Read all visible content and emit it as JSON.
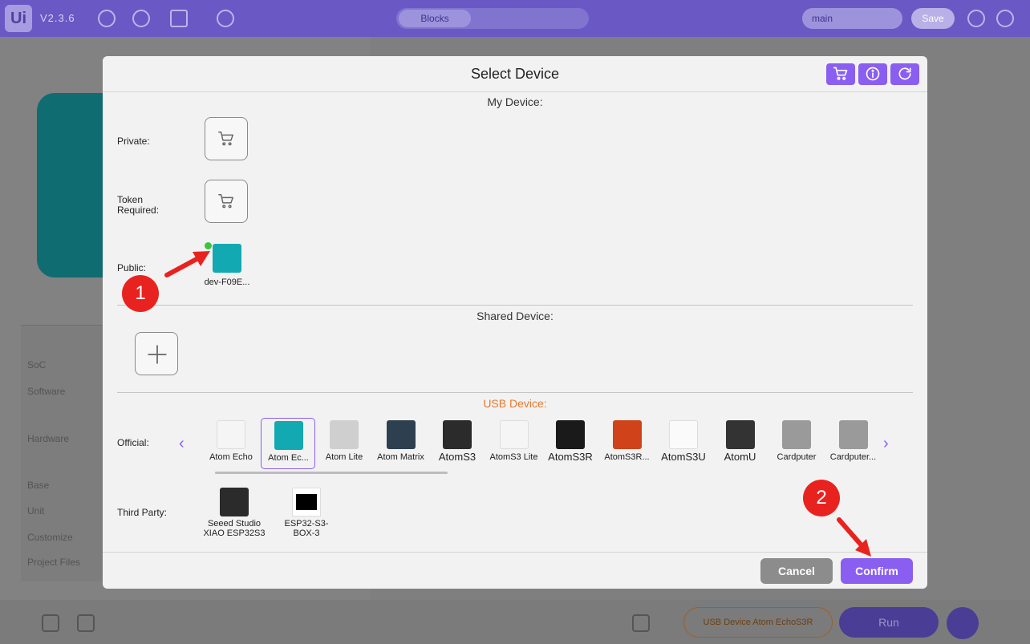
{
  "app": {
    "logo_text": "Ui",
    "version": "V2.3.6",
    "tab_blocks": "Blocks",
    "branch": "main",
    "save_label": "Save",
    "sidebar_rows": [
      "SoC",
      "Software",
      "Hardware",
      "Base",
      "Unit",
      "Customize",
      "Project Files"
    ],
    "usb_status": "USB Device  Atom EchoS3R",
    "run_label": "Run"
  },
  "modal": {
    "title": "Select Device",
    "header_buttons": [
      "cart-icon",
      "info-icon",
      "refresh-icon"
    ],
    "my_device": {
      "title": "My Device:",
      "private_label": "Private:",
      "token_label_line1": "Token",
      "token_label_line2": "Required:",
      "public_label": "Public:",
      "public_device_name": "dev-F09E..."
    },
    "shared_device": {
      "title": "Shared Device:"
    },
    "usb_device": {
      "title": "USB Device:",
      "official_label": "Official:",
      "third_party_label": "Third Party:",
      "official_devices": [
        {
          "label": "Atom Echo",
          "color": "#f5f5f5",
          "big": false
        },
        {
          "label": "Atom Ec...",
          "color": "#12a9b3",
          "big": false,
          "selected": true
        },
        {
          "label": "Atom Lite",
          "color": "#cfcfcf",
          "big": false
        },
        {
          "label": "Atom Matrix",
          "color": "#2e4050",
          "big": false
        },
        {
          "label": "AtomS3",
          "color": "#2b2b2b",
          "big": true
        },
        {
          "label": "AtomS3 Lite",
          "color": "#f5f5f5",
          "big": false
        },
        {
          "label": "AtomS3R",
          "color": "#1a1a1a",
          "big": true
        },
        {
          "label": "AtomS3R...",
          "color": "#d0431a",
          "big": false
        },
        {
          "label": "AtomS3U",
          "color": "#fafafa",
          "big": true
        },
        {
          "label": "AtomU",
          "color": "#333333",
          "big": true
        },
        {
          "label": "Cardputer",
          "color": "#9a9a9a",
          "big": false
        },
        {
          "label": "Cardputer...",
          "color": "#9a9a9a",
          "big": false
        }
      ],
      "third_party_devices": [
        {
          "line1": "Seeed Studio",
          "line2": "XIAO ESP32S3"
        },
        {
          "line1": "ESP32-S3-",
          "line2": "BOX-3"
        }
      ]
    },
    "cancel_label": "Cancel",
    "confirm_label": "Confirm"
  },
  "annotations": {
    "step1": "1",
    "step2": "2"
  },
  "colors": {
    "accent": "#8a5ef0",
    "usb_title": "#e8782a",
    "badge": "#e8231f",
    "online": "#3ec33e"
  }
}
